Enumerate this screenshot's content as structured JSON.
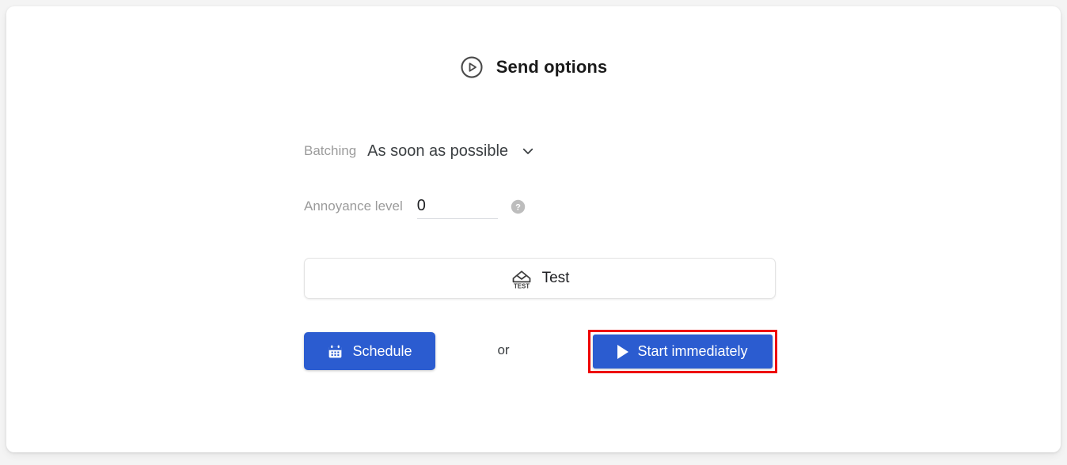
{
  "card": {
    "header": {
      "icon": "play-circle-icon",
      "title": "Send options"
    },
    "fields": {
      "batching": {
        "label": "Batching",
        "value": "As soon as possible",
        "chevron_icon": "chevron-down-icon"
      },
      "annoyance": {
        "label": "Annoyance level",
        "value": "0",
        "help_icon": "help-icon"
      }
    },
    "test_button": {
      "icon": "test-envelope-icon",
      "icon_text": "TEST",
      "label": "Test"
    },
    "actions": {
      "schedule": {
        "icon": "calendar-icon",
        "label": "Schedule"
      },
      "separator": "or",
      "start": {
        "icon": "play-triangle-icon",
        "label": "Start immediately",
        "highlighted": true
      }
    }
  },
  "colors": {
    "primary_blue": "#2b5cd0",
    "highlight_red": "#ee0000",
    "label_grey": "#9b9b9b",
    "text_dark": "#202124",
    "card_background": "#ffffff",
    "page_background": "#f4f4f4"
  }
}
